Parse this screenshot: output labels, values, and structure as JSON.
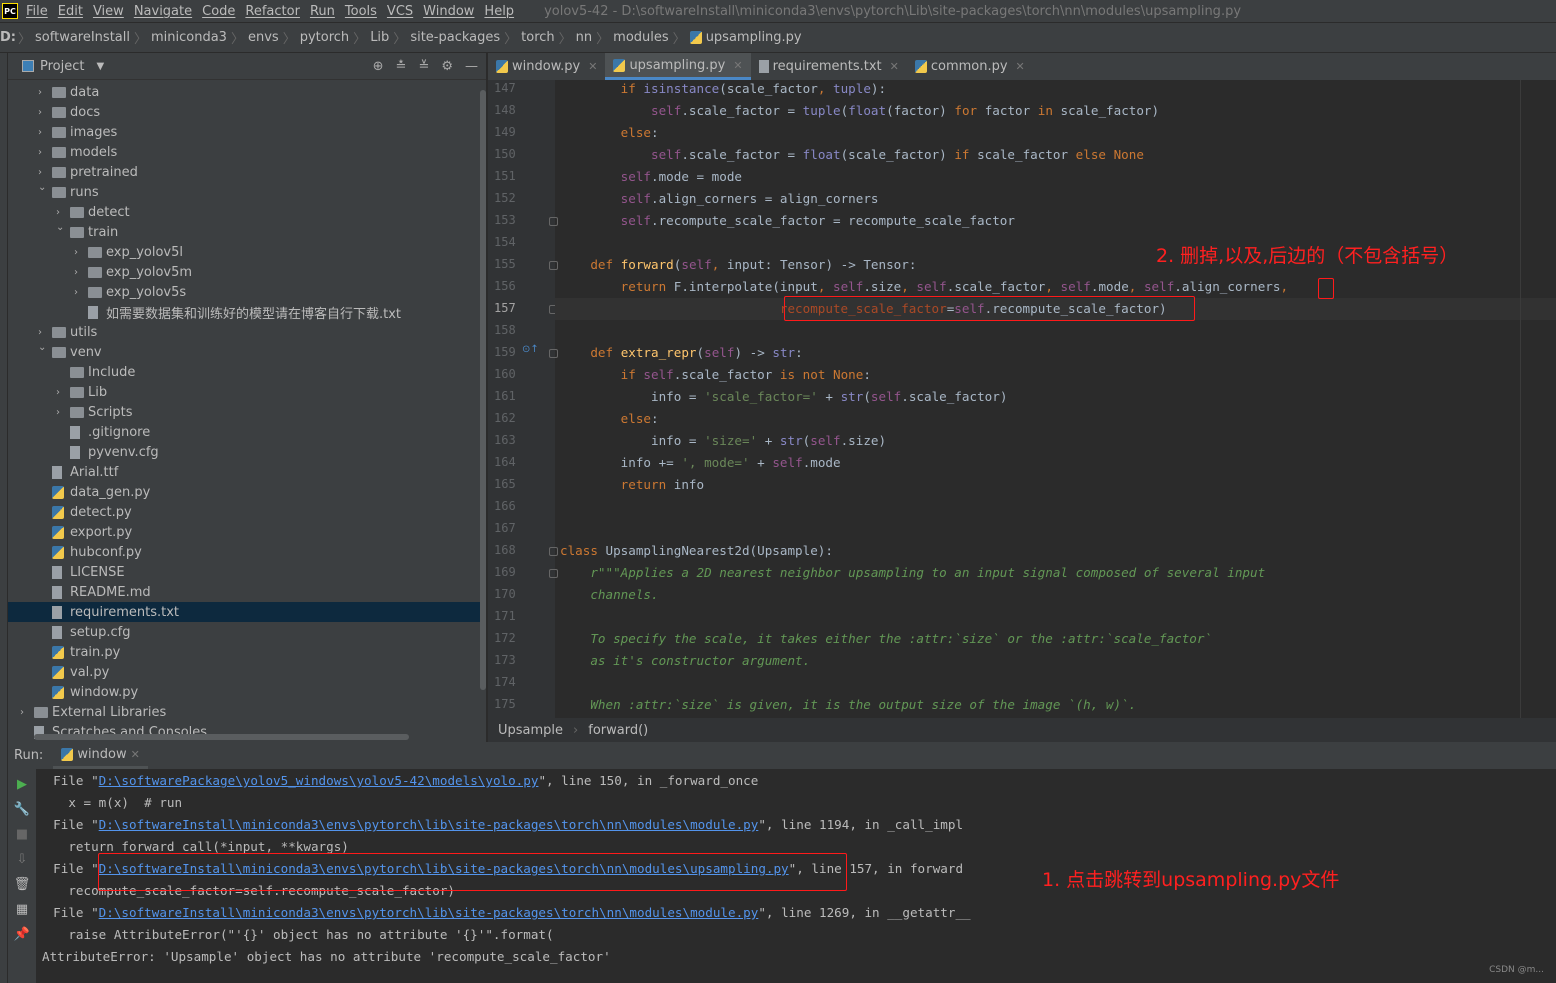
{
  "window": {
    "title": "yolov5-42 - D:\\softwareInstall\\miniconda3\\envs\\pytorch\\Lib\\site-packages\\torch\\nn\\modules\\upsampling.py",
    "logo": "PC"
  },
  "menu": [
    "File",
    "Edit",
    "View",
    "Navigate",
    "Code",
    "Refactor",
    "Run",
    "Tools",
    "VCS",
    "Window",
    "Help"
  ],
  "breadcrumb": [
    "D:",
    "softwareInstall",
    "miniconda3",
    "envs",
    "pytorch",
    "Lib",
    "site-packages",
    "torch",
    "nn",
    "modules",
    "upsampling.py"
  ],
  "project": {
    "title": "Project",
    "items": [
      {
        "label": "data",
        "level": 1,
        "type": "folder",
        "arrow": "closed"
      },
      {
        "label": "docs",
        "level": 1,
        "type": "folder",
        "arrow": "closed"
      },
      {
        "label": "images",
        "level": 1,
        "type": "folder",
        "arrow": "closed"
      },
      {
        "label": "models",
        "level": 1,
        "type": "folder",
        "arrow": "closed"
      },
      {
        "label": "pretrained",
        "level": 1,
        "type": "folder",
        "arrow": "closed"
      },
      {
        "label": "runs",
        "level": 1,
        "type": "folder",
        "arrow": "open"
      },
      {
        "label": "detect",
        "level": 2,
        "type": "folder",
        "arrow": "closed"
      },
      {
        "label": "train",
        "level": 2,
        "type": "folder",
        "arrow": "open"
      },
      {
        "label": "exp_yolov5l",
        "level": 3,
        "type": "folder",
        "arrow": "closed"
      },
      {
        "label": "exp_yolov5m",
        "level": 3,
        "type": "folder",
        "arrow": "closed"
      },
      {
        "label": "exp_yolov5s",
        "level": 3,
        "type": "folder",
        "arrow": "closed"
      },
      {
        "label": "如需要数据集和训练好的模型请在博客自行下载.txt",
        "level": 3,
        "type": "file",
        "arrow": ""
      },
      {
        "label": "utils",
        "level": 1,
        "type": "folder",
        "arrow": "closed"
      },
      {
        "label": "venv",
        "level": 1,
        "type": "folder",
        "arrow": "open"
      },
      {
        "label": "Include",
        "level": 2,
        "type": "folder",
        "arrow": ""
      },
      {
        "label": "Lib",
        "level": 2,
        "type": "folder",
        "arrow": "closed"
      },
      {
        "label": "Scripts",
        "level": 2,
        "type": "folder",
        "arrow": "closed"
      },
      {
        "label": ".gitignore",
        "level": 2,
        "type": "file",
        "arrow": ""
      },
      {
        "label": "pyvenv.cfg",
        "level": 2,
        "type": "file",
        "arrow": ""
      },
      {
        "label": "Arial.ttf",
        "level": 1,
        "type": "file",
        "arrow": ""
      },
      {
        "label": "data_gen.py",
        "level": 1,
        "type": "py",
        "arrow": ""
      },
      {
        "label": "detect.py",
        "level": 1,
        "type": "py",
        "arrow": ""
      },
      {
        "label": "export.py",
        "level": 1,
        "type": "py",
        "arrow": ""
      },
      {
        "label": "hubconf.py",
        "level": 1,
        "type": "py",
        "arrow": ""
      },
      {
        "label": "LICENSE",
        "level": 1,
        "type": "file",
        "arrow": ""
      },
      {
        "label": "README.md",
        "level": 1,
        "type": "file",
        "arrow": ""
      },
      {
        "label": "requirements.txt",
        "level": 1,
        "type": "file",
        "arrow": "",
        "selected": true
      },
      {
        "label": "setup.cfg",
        "level": 1,
        "type": "file",
        "arrow": ""
      },
      {
        "label": "train.py",
        "level": 1,
        "type": "py",
        "arrow": ""
      },
      {
        "label": "val.py",
        "level": 1,
        "type": "py",
        "arrow": ""
      },
      {
        "label": "window.py",
        "level": 1,
        "type": "py",
        "arrow": ""
      },
      {
        "label": "External Libraries",
        "level": 0,
        "type": "folder",
        "arrow": "closed"
      },
      {
        "label": "Scratches and Consoles",
        "level": 0,
        "type": "file",
        "arrow": ""
      }
    ]
  },
  "tabs": [
    {
      "label": "window.py",
      "type": "py"
    },
    {
      "label": "upsampling.py",
      "type": "py",
      "active": true
    },
    {
      "label": "requirements.txt",
      "type": "file"
    },
    {
      "label": "common.py",
      "type": "py"
    }
  ],
  "editor": {
    "current_line": 157,
    "lines": [
      {
        "n": 147,
        "t": [
          [
            "        ",
            "n"
          ],
          [
            "if ",
            "k"
          ],
          [
            "isinstance",
            "b"
          ],
          [
            "(scale_factor",
            "n"
          ],
          [
            ", ",
            "k"
          ],
          [
            "tuple",
            "b"
          ],
          [
            "):",
            "n"
          ]
        ]
      },
      {
        "n": 148,
        "t": [
          [
            "            ",
            "n"
          ],
          [
            "self",
            "s"
          ],
          [
            ".scale_factor = ",
            "n"
          ],
          [
            "tuple",
            "b"
          ],
          [
            "(",
            "n"
          ],
          [
            "float",
            "b"
          ],
          [
            "(factor) ",
            "n"
          ],
          [
            "for ",
            "k"
          ],
          [
            "factor ",
            "n"
          ],
          [
            "in ",
            "k"
          ],
          [
            "scale_factor)",
            "n"
          ]
        ]
      },
      {
        "n": 149,
        "t": [
          [
            "        ",
            "n"
          ],
          [
            "else",
            "k"
          ],
          [
            ":",
            "n"
          ]
        ]
      },
      {
        "n": 150,
        "t": [
          [
            "            ",
            "n"
          ],
          [
            "self",
            "s"
          ],
          [
            ".scale_factor = ",
            "n"
          ],
          [
            "float",
            "b"
          ],
          [
            "(scale_factor) ",
            "n"
          ],
          [
            "if ",
            "k"
          ],
          [
            "scale_factor ",
            "n"
          ],
          [
            "else ",
            "k"
          ],
          [
            "None",
            "k"
          ]
        ]
      },
      {
        "n": 151,
        "t": [
          [
            "        ",
            "n"
          ],
          [
            "self",
            "s"
          ],
          [
            ".mode = mode",
            "n"
          ]
        ]
      },
      {
        "n": 152,
        "t": [
          [
            "        ",
            "n"
          ],
          [
            "self",
            "s"
          ],
          [
            ".align_corners = align_corners",
            "n"
          ]
        ]
      },
      {
        "n": 153,
        "t": [
          [
            "        ",
            "n"
          ],
          [
            "self",
            "s"
          ],
          [
            ".recompute_scale_factor = recompute_scale_factor",
            "n"
          ]
        ]
      },
      {
        "n": 154,
        "t": []
      },
      {
        "n": 155,
        "t": [
          [
            "    ",
            "n"
          ],
          [
            "def ",
            "k"
          ],
          [
            "forward",
            "f"
          ],
          [
            "(",
            "n"
          ],
          [
            "self",
            "s"
          ],
          [
            ", ",
            "k"
          ],
          [
            "input: Tensor) -> Tensor:",
            "n"
          ]
        ]
      },
      {
        "n": 156,
        "t": [
          [
            "        ",
            "n"
          ],
          [
            "return ",
            "k"
          ],
          [
            "F.interpolate(input",
            "n"
          ],
          [
            ", ",
            "k"
          ],
          [
            "self",
            "s"
          ],
          [
            ".size",
            "n"
          ],
          [
            ", ",
            "k"
          ],
          [
            "self",
            "s"
          ],
          [
            ".scale_factor",
            "n"
          ],
          [
            ", ",
            "k"
          ],
          [
            "self",
            "s"
          ],
          [
            ".mode",
            "n"
          ],
          [
            ", ",
            "k"
          ],
          [
            "self",
            "s"
          ],
          [
            ".align_corners",
            "n"
          ],
          [
            ",",
            "k"
          ]
        ]
      },
      {
        "n": 157,
        "t": [
          [
            "                             ",
            "n"
          ],
          [
            "recompute_scale_factor",
            "p"
          ],
          [
            "=",
            "n"
          ],
          [
            "self",
            "s"
          ],
          [
            ".recompute_scale_factor)",
            "n"
          ]
        ]
      },
      {
        "n": 158,
        "t": []
      },
      {
        "n": 159,
        "t": [
          [
            "    ",
            "n"
          ],
          [
            "def ",
            "k"
          ],
          [
            "extra_repr",
            "f"
          ],
          [
            "(",
            "n"
          ],
          [
            "self",
            "s"
          ],
          [
            ") -> ",
            "n"
          ],
          [
            "str",
            "b"
          ],
          [
            ":",
            "n"
          ]
        ]
      },
      {
        "n": 160,
        "t": [
          [
            "        ",
            "n"
          ],
          [
            "if ",
            "k"
          ],
          [
            "self",
            "s"
          ],
          [
            ".scale_factor ",
            "n"
          ],
          [
            "is not None",
            "k"
          ],
          [
            ":",
            "n"
          ]
        ]
      },
      {
        "n": 161,
        "t": [
          [
            "            ",
            "n"
          ],
          [
            "info = ",
            "n"
          ],
          [
            "'scale_factor='",
            "str"
          ],
          [
            " + ",
            "n"
          ],
          [
            "str",
            "b"
          ],
          [
            "(",
            "n"
          ],
          [
            "self",
            "s"
          ],
          [
            ".scale_factor)",
            "n"
          ]
        ]
      },
      {
        "n": 162,
        "t": [
          [
            "        ",
            "n"
          ],
          [
            "else",
            "k"
          ],
          [
            ":",
            "n"
          ]
        ]
      },
      {
        "n": 163,
        "t": [
          [
            "            ",
            "n"
          ],
          [
            "info = ",
            "n"
          ],
          [
            "'size='",
            "str"
          ],
          [
            " + ",
            "n"
          ],
          [
            "str",
            "b"
          ],
          [
            "(",
            "n"
          ],
          [
            "self",
            "s"
          ],
          [
            ".size)",
            "n"
          ]
        ]
      },
      {
        "n": 164,
        "t": [
          [
            "        ",
            "n"
          ],
          [
            "info += ",
            "n"
          ],
          [
            "', mode='",
            "str"
          ],
          [
            " + ",
            "n"
          ],
          [
            "self",
            "s"
          ],
          [
            ".mode",
            "n"
          ]
        ]
      },
      {
        "n": 165,
        "t": [
          [
            "        ",
            "n"
          ],
          [
            "return ",
            "k"
          ],
          [
            "info",
            "n"
          ]
        ]
      },
      {
        "n": 166,
        "t": []
      },
      {
        "n": 167,
        "t": []
      },
      {
        "n": 168,
        "t": [
          [
            "class ",
            "k"
          ],
          [
            "UpsamplingNearest2d(Upsample):",
            "n"
          ]
        ]
      },
      {
        "n": 169,
        "t": [
          [
            "    ",
            "n"
          ],
          [
            "r\"\"\"Applies a 2D nearest neighbor upsampling to an input signal composed of several input",
            "doc"
          ]
        ]
      },
      {
        "n": 170,
        "t": [
          [
            "    channels.",
            "doc"
          ]
        ]
      },
      {
        "n": 171,
        "t": []
      },
      {
        "n": 172,
        "t": [
          [
            "    To specify the scale, it takes either the :attr:`size` or the :attr:`scale_factor`",
            "doc"
          ]
        ]
      },
      {
        "n": 173,
        "t": [
          [
            "    as it's constructor argument.",
            "doc"
          ]
        ]
      },
      {
        "n": 174,
        "t": []
      },
      {
        "n": 175,
        "t": [
          [
            "    When :attr:`size` is given, it is the output size of the image `(h, w)`.",
            "doc"
          ]
        ]
      }
    ]
  },
  "editor_breadcrumb": [
    "Upsample",
    "forward()"
  ],
  "annotations": {
    "note1": "1. 点击跳转到upsampling.py文件",
    "note2": "2. 删掉,以及,后边的（不包含括号）"
  },
  "run": {
    "label": "Run:",
    "tab": "window",
    "lines": [
      [
        [
          "  File \"",
          ""
        ],
        [
          "D:\\softwarePackage\\yolov5_windows\\yolov5-42\\models\\yolo.py",
          "lnk"
        ],
        [
          "\", line 150, in _forward_once",
          ""
        ]
      ],
      [
        [
          "    x = m(x)  # run",
          ""
        ]
      ],
      [
        [
          "  File \"",
          ""
        ],
        [
          "D:\\softwareInstall\\miniconda3\\envs\\pytorch\\lib\\site-packages\\torch\\nn\\modules\\module.py",
          "lnk"
        ],
        [
          "\", line 1194, in _call_impl",
          ""
        ]
      ],
      [
        [
          "    return forward_call(*input, **kwargs)",
          ""
        ]
      ],
      [
        [
          "  File \"",
          ""
        ],
        [
          "D:\\softwareInstall\\miniconda3\\envs\\pytorch\\lib\\site-packages\\torch\\nn\\modules\\upsampling.py",
          "lnk"
        ],
        [
          "\", line 157, in forward",
          ""
        ]
      ],
      [
        [
          "    recompute_scale_factor=self.recompute_scale_factor)",
          ""
        ]
      ],
      [
        [
          "  File \"",
          ""
        ],
        [
          "D:\\softwareInstall\\miniconda3\\envs\\pytorch\\lib\\site-packages\\torch\\nn\\modules\\module.py",
          "lnk"
        ],
        [
          "\", line 1269, in __getattr__",
          ""
        ]
      ],
      [
        [
          "    raise AttributeError(\"'{}' object has no attribute '{}'\".format(",
          ""
        ]
      ],
      [
        [
          "AttributeError: 'Upsample' object has no attribute 'recompute_scale_factor'",
          ""
        ]
      ]
    ]
  },
  "watermark": "CSDN @m..."
}
